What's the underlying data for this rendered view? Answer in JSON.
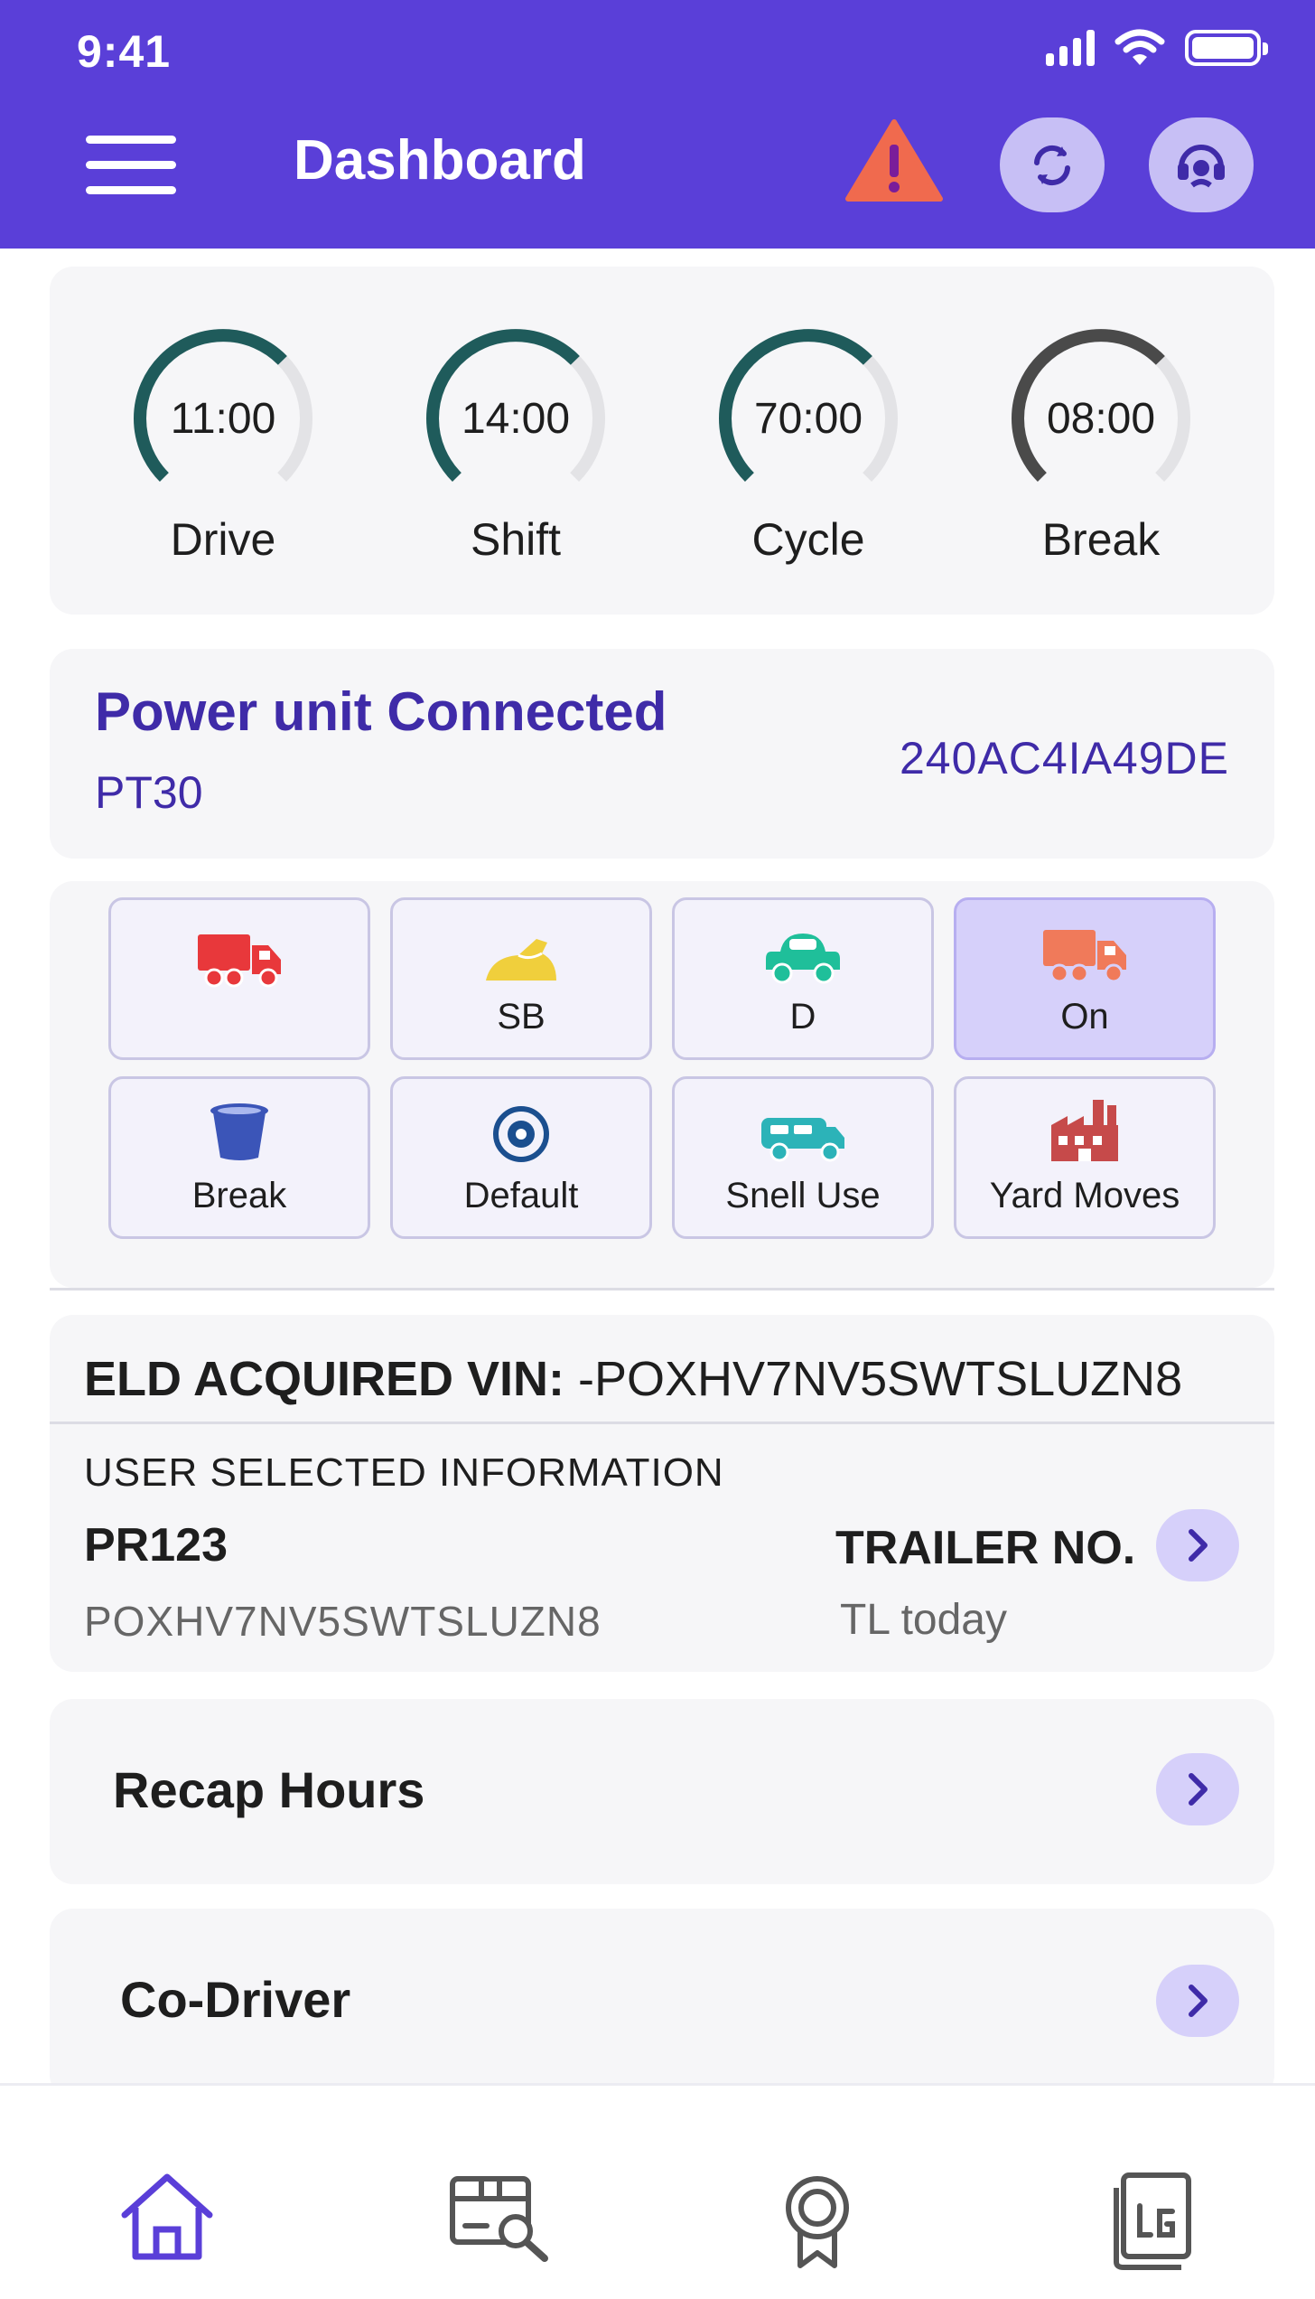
{
  "status_bar": {
    "time": "9:41",
    "icons": [
      "signal-icon",
      "wifi-icon",
      "battery-icon"
    ]
  },
  "header": {
    "title": "Dashboard",
    "icons": [
      "menu-icon",
      "warning-icon",
      "sync-icon",
      "support-icon"
    ]
  },
  "timers": [
    {
      "value": "11:00",
      "label": "Drive",
      "color": "#1f5b5b"
    },
    {
      "value": "14:00",
      "label": "Shift",
      "color": "#1f5b5b"
    },
    {
      "value": "70:00",
      "label": "Cycle",
      "color": "#1f5b5b"
    },
    {
      "value": "08:00",
      "label": "Break",
      "color": "#4a4a4a"
    }
  ],
  "power_unit": {
    "title": "Power unit Connected",
    "unit": "PT30",
    "id": "240AC4IA49DE"
  },
  "duty_status": [
    {
      "label": "",
      "icon": "truck-icon",
      "color": "#e8383b",
      "active": false
    },
    {
      "label": "SB",
      "icon": "sleeper-icon",
      "color": "#f0cf3c",
      "active": false
    },
    {
      "label": "D",
      "icon": "car-icon",
      "color": "#1fbf9a",
      "active": false
    },
    {
      "label": "On",
      "icon": "truck-icon",
      "color": "#f07a5a",
      "active": true
    },
    {
      "label": "Break",
      "icon": "cup-icon",
      "color": "#3b55b8",
      "active": false
    },
    {
      "label": "Default",
      "icon": "eye-icon",
      "color": "#1b4f8f",
      "active": false
    },
    {
      "label": "Snell Use",
      "icon": "rv-icon",
      "color": "#2cb3b8",
      "active": false
    },
    {
      "label": "Yard Moves",
      "icon": "factory-icon",
      "color": "#c64a4a",
      "active": false
    }
  ],
  "vin": {
    "eld_label": "ELD ACQUIRED VIN:",
    "eld_value": "-POXHV7NV5SWTSLUZN8",
    "user_selected_label": "USER SELECTED INFORMATION",
    "power_unit": "PR123",
    "power_unit_vin": "POXHV7NV5SWTSLUZN8",
    "trailer_label": "TRAILER NO.",
    "trailer_value": "TL today"
  },
  "rows": {
    "recap": "Recap Hours",
    "codriver": "Co-Driver"
  },
  "bottom_nav": [
    "home-icon",
    "inspection-icon",
    "certify-icon",
    "logs-icon"
  ],
  "colors": {
    "primary": "#5a3fd8",
    "accent_soft": "#d6d0fa",
    "card_bg": "#f6f6f8",
    "text_accent": "#3f2ba8"
  }
}
